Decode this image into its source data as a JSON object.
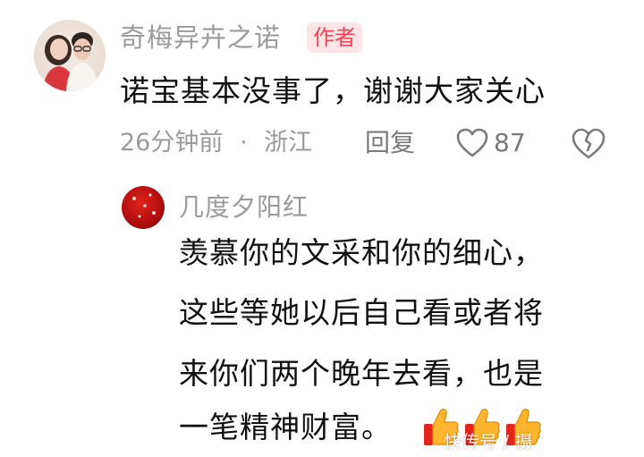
{
  "comment": {
    "username": "奇梅异卉之诺",
    "badge": "作者",
    "text": "诺宝基本没事了，谢谢大家关心",
    "time": "26分钟前",
    "separator": "·",
    "location": "浙江",
    "reply_label": "回复",
    "like_count": "87",
    "icons": {
      "like": "heart-outline-icon",
      "dislike": "broken-heart-icon"
    }
  },
  "reply": {
    "username": "几度夕阳红",
    "lines": [
      "羡慕你的文采和你的细心，",
      "这些等她以后自己看或者将",
      "来你们两个晚年去看，也是",
      "一笔精神财富。"
    ],
    "emoji": [
      "thumbs-up-icon",
      "thumbs-up-icon",
      "thumbs-up-icon"
    ]
  },
  "watermark": "快传号 / 摄",
  "colors": {
    "username_gray": "#9a9a9a",
    "badge_bg": "#fde4e6",
    "badge_text": "#f24457",
    "text": "#111111"
  }
}
